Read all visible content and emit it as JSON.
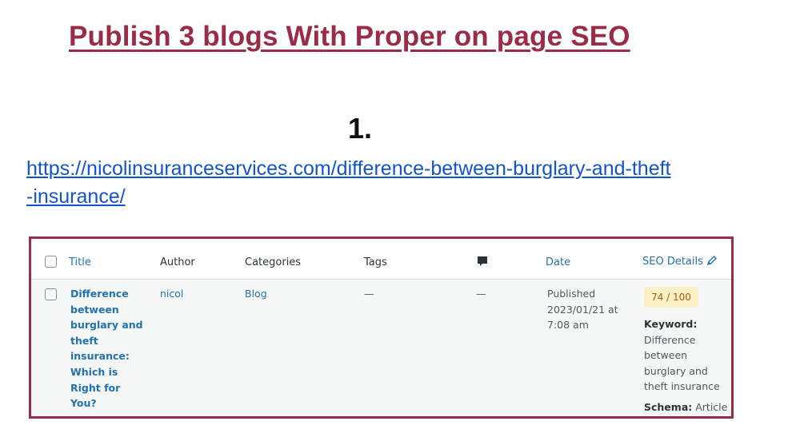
{
  "heading": "Publish 3 blogs With Proper on page SEO",
  "item_number": "1.",
  "url_line1": "https://nicolinsuranceservices.com/difference-between-burglary-and-theft",
  "url_line2": "-insurance/",
  "table": {
    "columns": {
      "title": "Title",
      "author": "Author",
      "categories": "Categories",
      "tags": "Tags",
      "date": "Date",
      "seo_details": "SEO Details"
    },
    "row": {
      "title_lines": [
        "Difference",
        "between",
        "burglary and",
        "theft",
        "insurance:",
        "Which is",
        "Right for You?"
      ],
      "author": "nicol",
      "category": "Blog",
      "tags": "—",
      "comments": "—",
      "date_lines": [
        "Published",
        "2023/01/21 at",
        "7:08 am"
      ],
      "seo_score": "74 / 100",
      "keyword_label": "Keyword:",
      "keyword_lines": [
        "Difference",
        "between",
        "burglary and",
        "theft insurance"
      ],
      "schema_label": "Schema:",
      "schema_value": "Article"
    }
  },
  "colors": {
    "heading": "#9b2c47",
    "frame_border": "#9b2c47",
    "link": "#2271b1",
    "url": "#1155cc",
    "score_bg": "#fdf0c7"
  }
}
